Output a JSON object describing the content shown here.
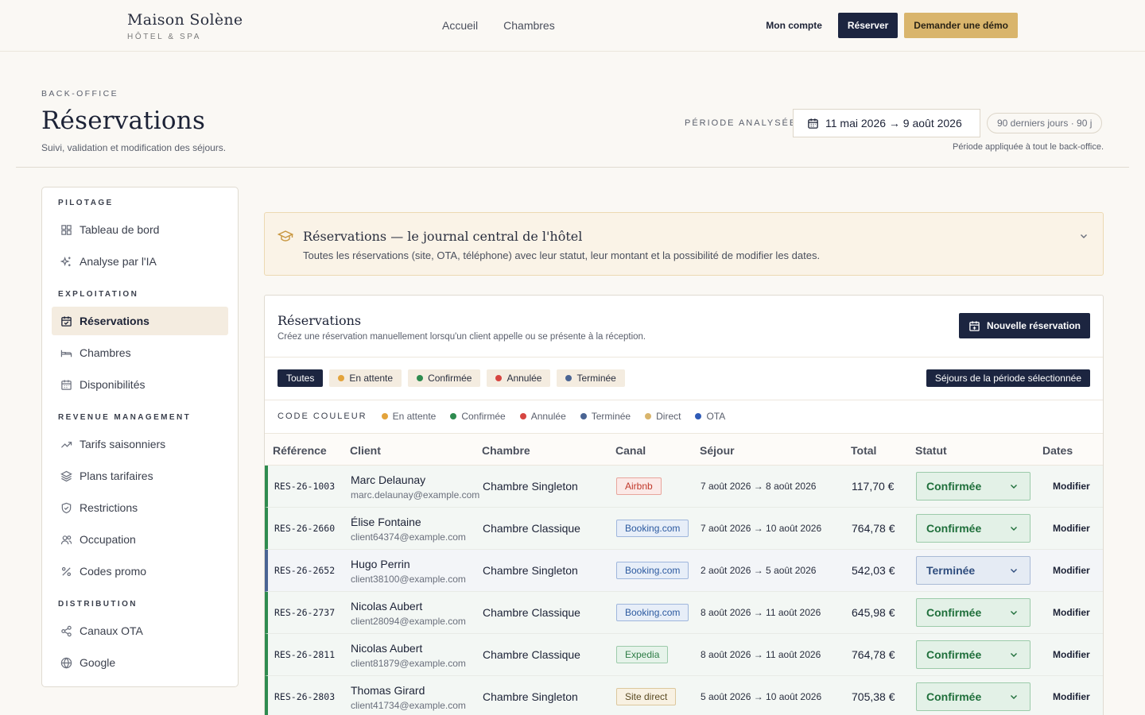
{
  "brand": {
    "name": "Maison Solène",
    "tagline": "HÔTEL & SPA"
  },
  "nav": {
    "links": [
      "Accueil",
      "Chambres"
    ],
    "account": "Mon compte",
    "reserve": "Réserver",
    "demo": "Demander une démo"
  },
  "header": {
    "crumb": "BACK-OFFICE",
    "title": "Réservations",
    "subtitle": "Suivi, validation et modification des séjours.",
    "period_label": "PÉRIODE ANALYSÉE",
    "period_range": "11 mai 2026 → 9 août 2026",
    "period_pill": "90 derniers jours · 90 j",
    "period_note": "Période appliquée à tout le back-office."
  },
  "sidebar": {
    "sections": [
      "PILOTAGE",
      "EXPLOITATION",
      "REVENUE MANAGEMENT",
      "DISTRIBUTION"
    ],
    "items": [
      {
        "label": "Tableau de bord",
        "icon": "dashboard-icon"
      },
      {
        "label": "Analyse par l'IA",
        "icon": "sparkles-icon"
      },
      {
        "label": "Réservations",
        "icon": "calendar-check-icon",
        "active": true
      },
      {
        "label": "Chambres",
        "icon": "bed-icon"
      },
      {
        "label": "Disponibilités",
        "icon": "calendar-icon"
      },
      {
        "label": "Tarifs saisonniers",
        "icon": "trend-icon"
      },
      {
        "label": "Plans tarifaires",
        "icon": "layers-icon"
      },
      {
        "label": "Restrictions",
        "icon": "shield-icon"
      },
      {
        "label": "Occupation",
        "icon": "users-icon"
      },
      {
        "label": "Codes promo",
        "icon": "percent-icon"
      },
      {
        "label": "Canaux OTA",
        "icon": "share-icon"
      },
      {
        "label": "Google",
        "icon": "globe-icon"
      }
    ]
  },
  "banner": {
    "title": "Réservations — le journal central de l'hôtel",
    "text": "Toutes les réservations (site, OTA, téléphone) avec leur statut, leur montant et la possibilité de modifier les dates."
  },
  "card": {
    "title": "Réservations",
    "subtitle": "Créez une réservation manuellement lorsqu'un client appelle ou se présente à la réception.",
    "new_button": "Nouvelle réservation",
    "filters": [
      "Toutes",
      "En attente",
      "Confirmée",
      "Annulée",
      "Terminée"
    ],
    "period_button": "Séjours de la période sélectionnée",
    "legend_title": "CODE COULEUR",
    "legend": [
      "En attente",
      "Confirmée",
      "Annulée",
      "Terminée",
      "Direct",
      "OTA"
    ]
  },
  "colors": {
    "pending": "#e3a33b",
    "confirmed": "#2e8b4f",
    "cancelled": "#d64541",
    "finished": "#4a6493",
    "direct": "#d9b56c",
    "ota": "#2f5bb7"
  },
  "table": {
    "headers": [
      "Référence",
      "Client",
      "Chambre",
      "Canal",
      "Séjour",
      "Total",
      "Statut",
      "Dates"
    ],
    "rows": [
      {
        "ref": "RES-26-1003",
        "name": "Marc Delaunay",
        "email": "marc.delaunay@example.com",
        "room": "Chambre Singleton",
        "channel": "Airbnb",
        "stay": "7 août 2026 → 8 août 2026",
        "total": "117,70 €",
        "status": "Confirmée",
        "action": "Modifier"
      },
      {
        "ref": "RES-26-2660",
        "name": "Élise Fontaine",
        "email": "client64374@example.com",
        "room": "Chambre Classique",
        "channel": "Booking.com",
        "stay": "7 août 2026 → 10 août 2026",
        "total": "764,78 €",
        "status": "Confirmée",
        "action": "Modifier"
      },
      {
        "ref": "RES-26-2652",
        "name": "Hugo Perrin",
        "email": "client38100@example.com",
        "room": "Chambre Singleton",
        "channel": "Booking.com",
        "stay": "2 août 2026 → 5 août 2026",
        "total": "542,03 €",
        "status": "Terminée",
        "action": "Modifier"
      },
      {
        "ref": "RES-26-2737",
        "name": "Nicolas Aubert",
        "email": "client28094@example.com",
        "room": "Chambre Classique",
        "channel": "Booking.com",
        "stay": "8 août 2026 → 11 août 2026",
        "total": "645,98 €",
        "status": "Confirmée",
        "action": "Modifier"
      },
      {
        "ref": "RES-26-2811",
        "name": "Nicolas Aubert",
        "email": "client81879@example.com",
        "room": "Chambre Classique",
        "channel": "Expedia",
        "stay": "8 août 2026 → 11 août 2026",
        "total": "764,78 €",
        "status": "Confirmée",
        "action": "Modifier"
      },
      {
        "ref": "RES-26-2803",
        "name": "Thomas Girard",
        "email": "client41734@example.com",
        "room": "Chambre Singleton",
        "channel": "Site direct",
        "stay": "5 août 2026 → 10 août 2026",
        "total": "705,38 €",
        "status": "Confirmée",
        "action": "Modifier"
      }
    ]
  }
}
